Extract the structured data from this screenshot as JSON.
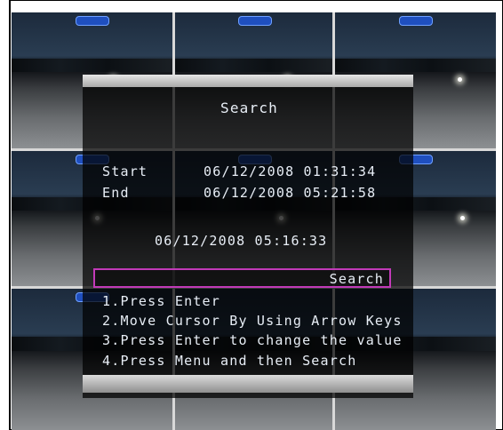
{
  "camera_badge_text": "",
  "dialog": {
    "title": "Search",
    "start_label": "Start",
    "start_value": "06/12/2008 01:31:34",
    "end_label": "End",
    "end_value": "06/12/2008 05:21:58",
    "current_value": "06/12/2008 05:16:33",
    "search_button_label": "Search",
    "steps": [
      "1.Press Enter",
      "2.Move Cursor By Using Arrow Keys",
      "3.Press Enter to change the value",
      "4.Press Menu and then Search"
    ]
  },
  "colors": {
    "highlight_border": "#c23ab8",
    "text": "#e8eef6",
    "separator": "#d8d8d8",
    "camera_badge": "#1f4fbf"
  },
  "icons": [
    "camera-status-badge"
  ]
}
